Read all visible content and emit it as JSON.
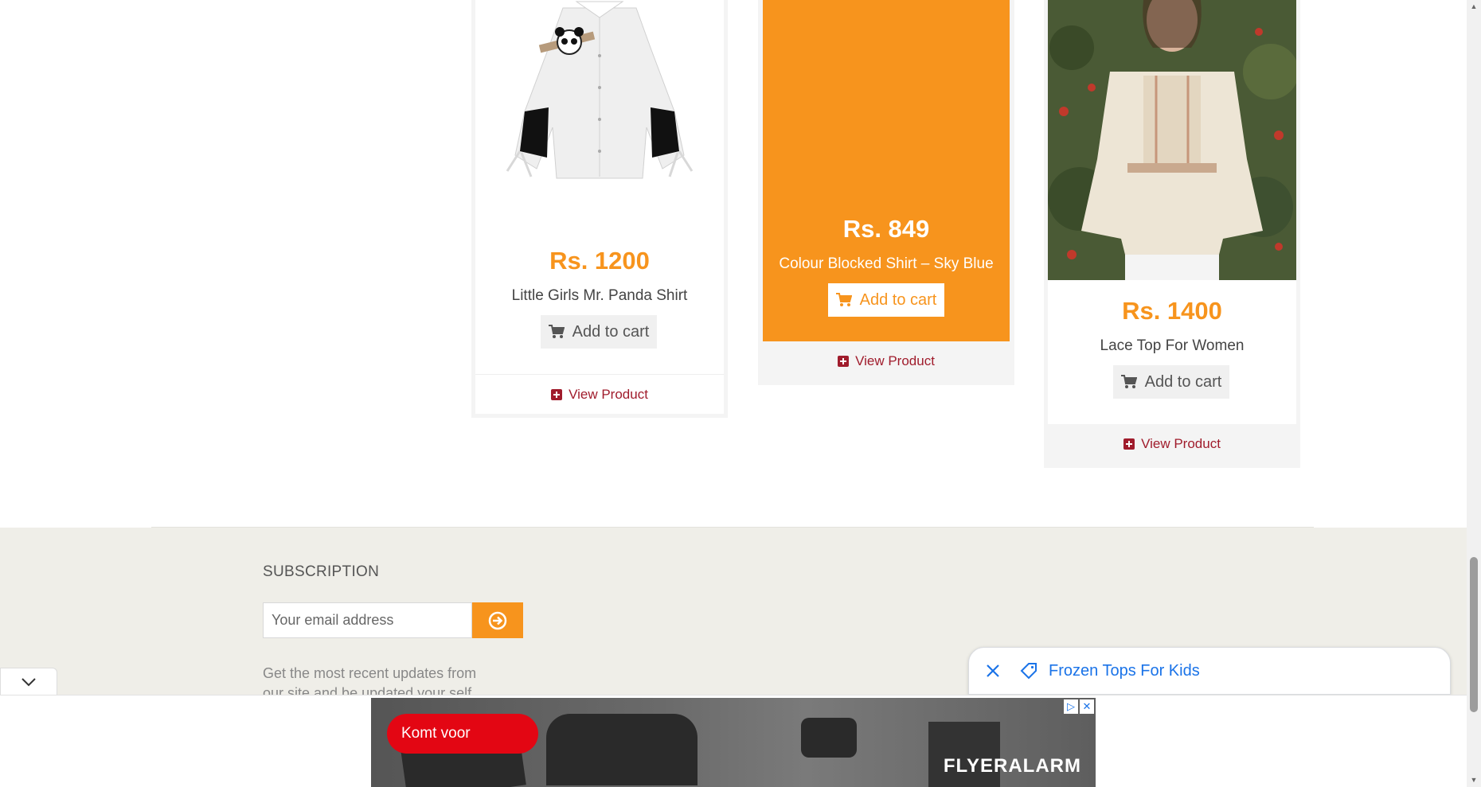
{
  "products": [
    {
      "price": "Rs. 1200",
      "name": "Little Girls Mr. Panda Shirt",
      "cart_label": "Add to cart",
      "view_label": "View Product"
    },
    {
      "price": "Rs. 849",
      "name": "Colour Blocked Shirt – Sky Blue",
      "cart_label": "Add to cart",
      "view_label": "View Product"
    },
    {
      "price": "Rs. 1400",
      "name": "Lace Top For Women",
      "cart_label": "Add to cart",
      "view_label": "View Product"
    }
  ],
  "footer": {
    "subscription_title": "SUBSCRIPTION",
    "email_placeholder": "Your email address",
    "description": "Get the most recent updates from our site and be updated your self..."
  },
  "chip": {
    "text": "Frozen Tops For Kids"
  },
  "ad": {
    "cta": "Komt voor",
    "brand": "FLYERALARM"
  },
  "colors": {
    "accent": "#f7941d",
    "link": "#a01c2c",
    "footer_bg": "#efeee8",
    "chip_text": "#1a73e8"
  }
}
